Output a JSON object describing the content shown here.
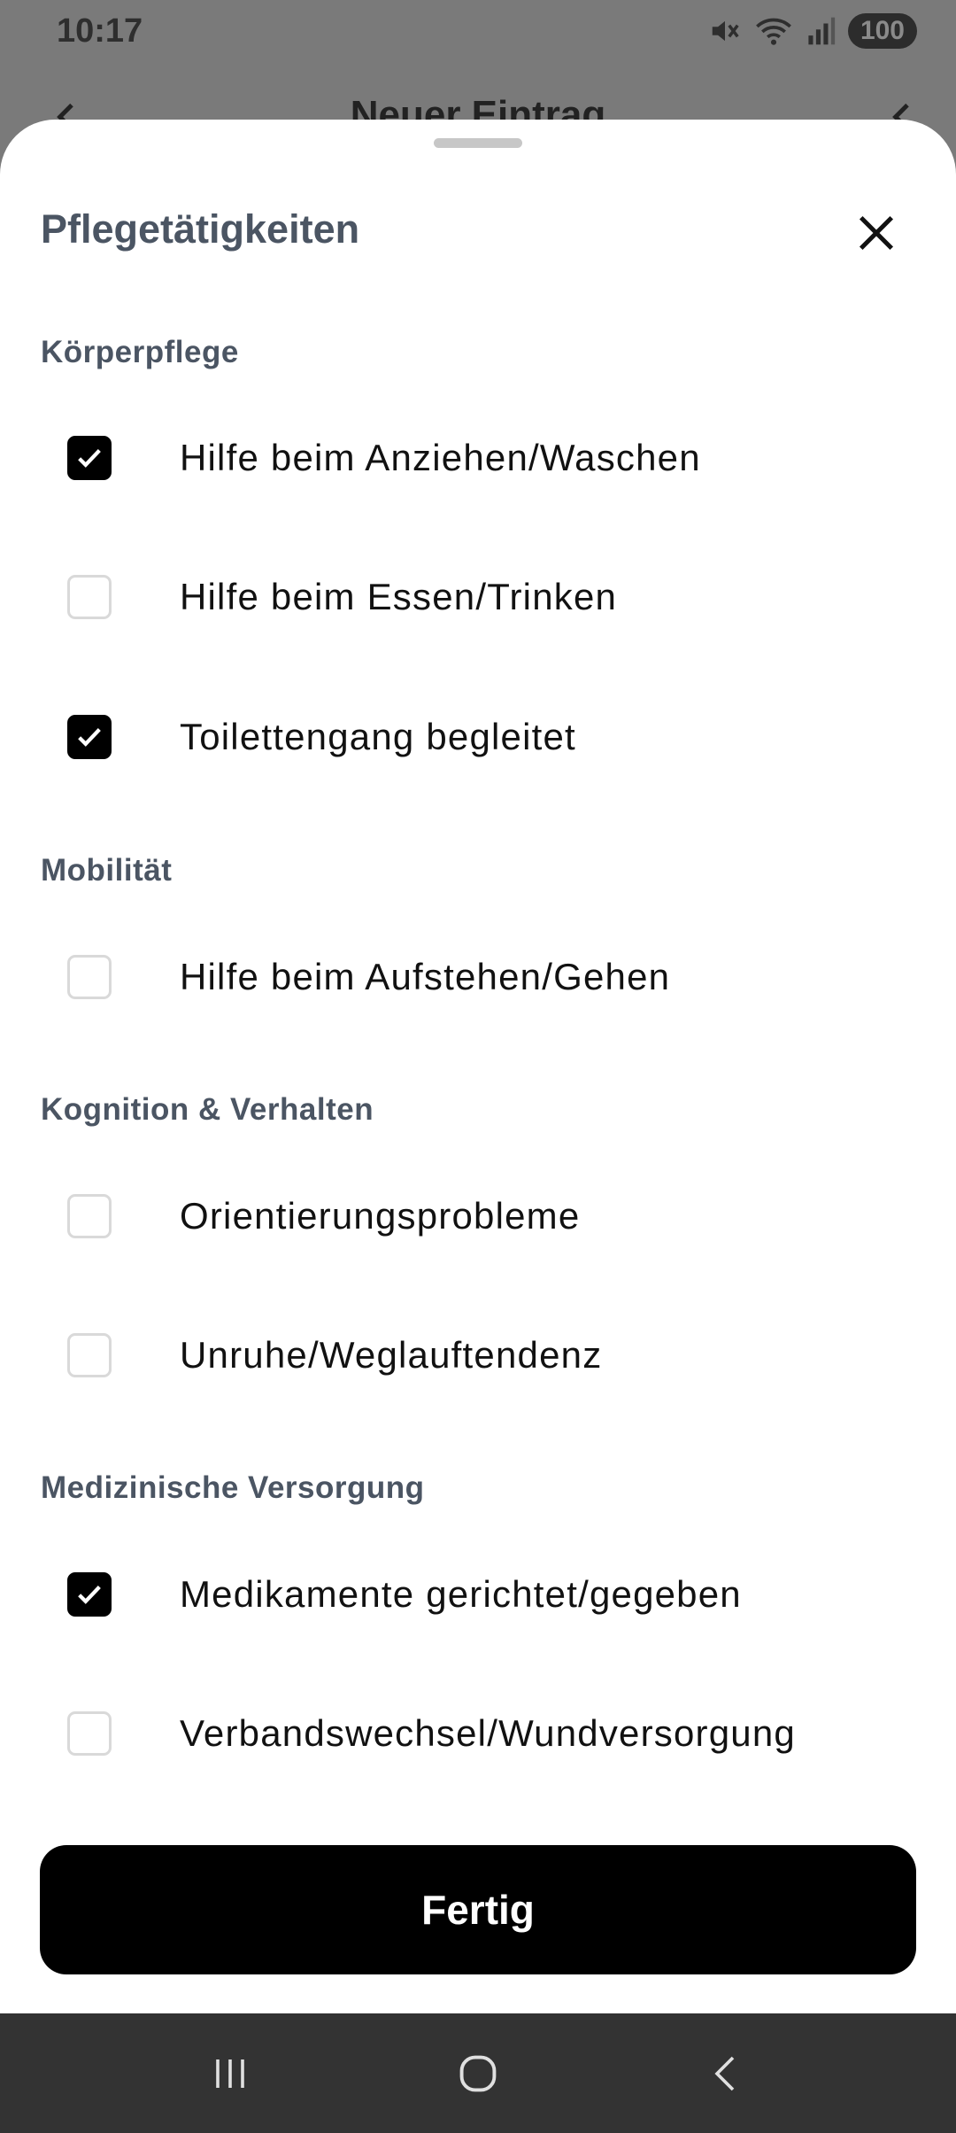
{
  "status_bar": {
    "time": "10:17",
    "battery": "100",
    "icons": [
      "mute-icon",
      "wifi-icon",
      "signal-icon",
      "battery-icon"
    ]
  },
  "behind": {
    "header_title": "Neuer Eintrag"
  },
  "sheet": {
    "title": "Pflegetätigkeiten",
    "sections": [
      {
        "heading": "Körperpflege",
        "options": [
          {
            "label": "Hilfe beim Anziehen/Waschen",
            "checked": true
          },
          {
            "label": "Hilfe beim Essen/Trinken",
            "checked": false
          },
          {
            "label": "Toilettengang begleitet",
            "checked": true
          }
        ]
      },
      {
        "heading": "Mobilität",
        "options": [
          {
            "label": "Hilfe beim Aufstehen/Gehen",
            "checked": false
          }
        ]
      },
      {
        "heading": "Kognition & Verhalten",
        "options": [
          {
            "label": "Orientierungsprobleme",
            "checked": false
          },
          {
            "label": "Unruhe/Weglauftendenz",
            "checked": false
          }
        ]
      },
      {
        "heading": "Medizinische Versorgung",
        "options": [
          {
            "label": "Medikamente gerichtet/gegeben",
            "checked": true
          },
          {
            "label": "Verbandswechsel/Wundversorgung",
            "checked": false
          }
        ]
      }
    ],
    "done_label": "Fertig"
  },
  "nav": {
    "buttons": [
      "recent-apps-icon",
      "home-icon",
      "back-icon"
    ]
  }
}
